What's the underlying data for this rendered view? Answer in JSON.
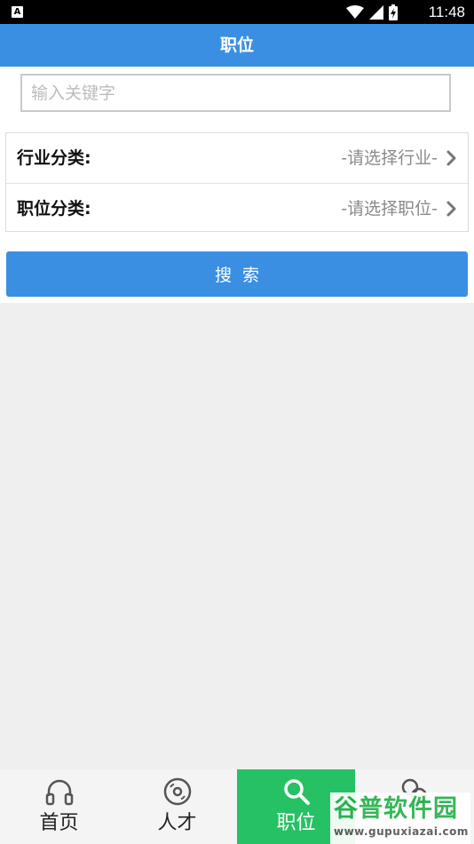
{
  "status_bar": {
    "time": "11:48",
    "left_icon": "A"
  },
  "header": {
    "title": "职位"
  },
  "search": {
    "placeholder": "输入关键字",
    "value": ""
  },
  "filters": [
    {
      "label": "行业分类:",
      "value": "-请选择行业-"
    },
    {
      "label": "职位分类:",
      "value": "-请选择职位-"
    }
  ],
  "search_button": {
    "label": "搜索"
  },
  "tabs": [
    {
      "label": "首页",
      "icon": "headphones-icon",
      "active": false
    },
    {
      "label": "人才",
      "icon": "disc-icon",
      "active": false
    },
    {
      "label": "职位",
      "icon": "search-icon",
      "active": true
    },
    {
      "label": "",
      "icon": "chat-icon",
      "active": false
    }
  ],
  "watermark": {
    "title": "谷普软件园",
    "url": "www.gupuxiazai.com"
  },
  "colors": {
    "primary": "#3a8fe3",
    "active_tab": "#26c164",
    "background": "#efefef"
  }
}
